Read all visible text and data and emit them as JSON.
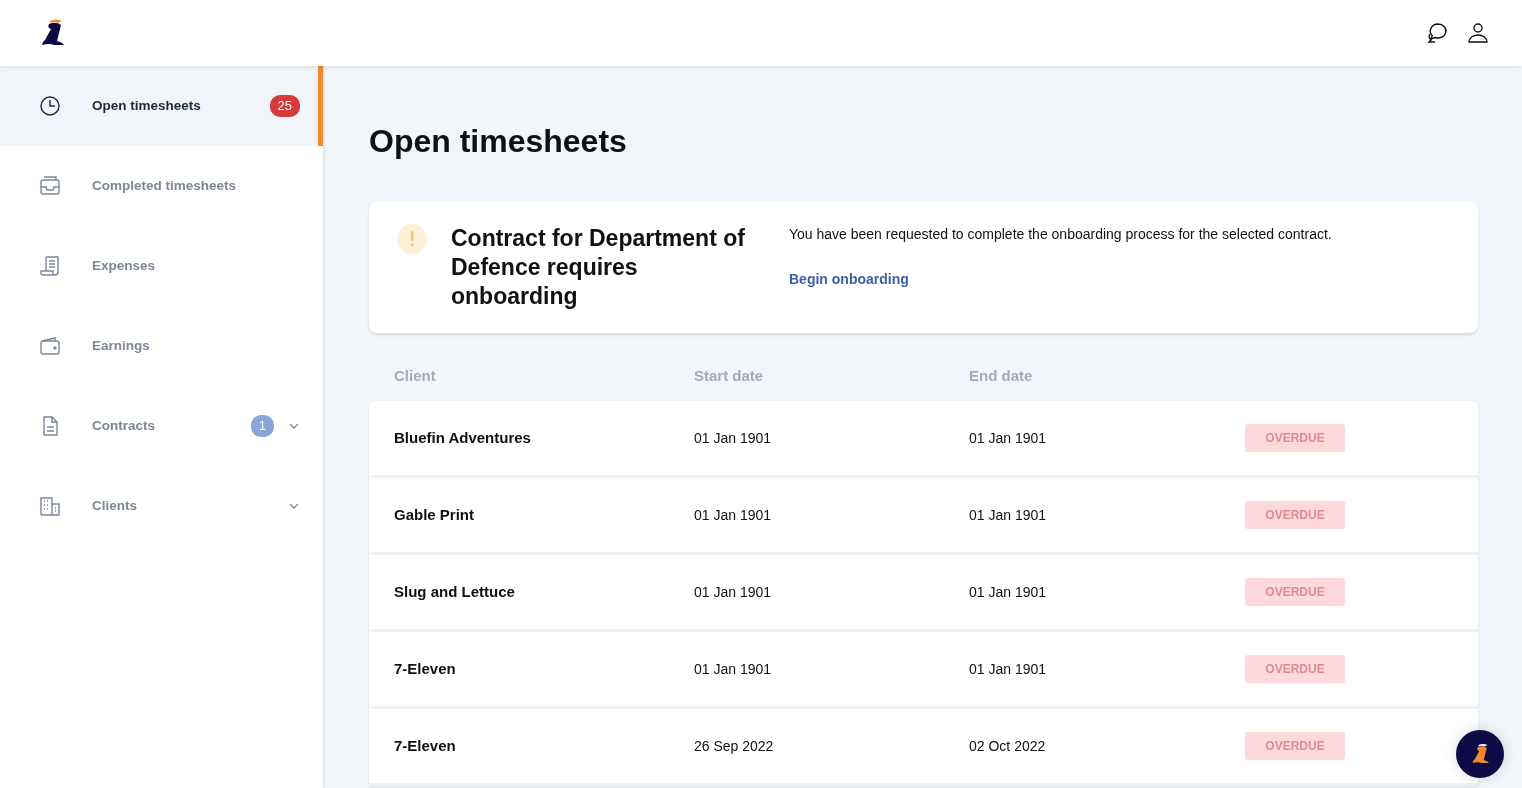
{
  "sidebar": {
    "items": [
      {
        "label": "Open timesheets",
        "selected": true,
        "badge": {
          "text": "25",
          "color": "#d63a3a"
        }
      },
      {
        "label": "Completed timesheets",
        "selected": false
      },
      {
        "label": "Expenses",
        "selected": false
      },
      {
        "label": "Earnings",
        "selected": false
      },
      {
        "label": "Contracts",
        "selected": false,
        "badge": {
          "text": "1",
          "color": "#8aa6d6"
        },
        "expanded": false
      },
      {
        "label": "Clients",
        "selected": false,
        "expanded": false
      }
    ]
  },
  "page_title": "Open timesheets",
  "alert": {
    "title": "Contract for Department of Defence requires onboarding",
    "message": "You have been requested to complete the onboarding process for the selected contract.",
    "link": "Begin onboarding"
  },
  "table": {
    "columns": [
      "Client",
      "Start date",
      "End date"
    ],
    "rows": [
      {
        "client": "Bluefin Adventures",
        "start": "01 Jan 1901",
        "end": "01 Jan 1901",
        "status": "OVERDUE"
      },
      {
        "client": "Gable Print",
        "start": "01 Jan 1901",
        "end": "01 Jan 1901",
        "status": "OVERDUE"
      },
      {
        "client": "Slug and Lettuce",
        "start": "01 Jan 1901",
        "end": "01 Jan 1901",
        "status": "OVERDUE"
      },
      {
        "client": "7-Eleven",
        "start": "01 Jan 1901",
        "end": "01 Jan 1901",
        "status": "OVERDUE"
      },
      {
        "client": "7-Eleven",
        "start": "26 Sep 2022",
        "end": "02 Oct 2022",
        "status": "OVERDUE"
      }
    ]
  }
}
